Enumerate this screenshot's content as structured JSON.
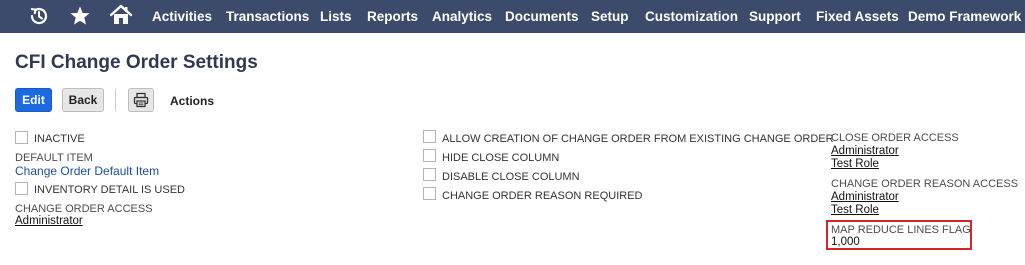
{
  "nav": {
    "items": [
      "Activities",
      "Transactions",
      "Lists",
      "Reports",
      "Analytics",
      "Documents",
      "Setup",
      "Customization",
      "Support",
      "Fixed Assets",
      "Demo Framework"
    ],
    "icons": [
      "recent-records-icon",
      "star-icon",
      "home-icon"
    ]
  },
  "page": {
    "title": "CFI Change Order Settings"
  },
  "toolbar": {
    "edit_label": "Edit",
    "back_label": "Back",
    "print_icon": "print-icon",
    "actions_label": "Actions"
  },
  "left": {
    "inactive_label": "INACTIVE",
    "default_item_label": "DEFAULT ITEM",
    "default_item_value": "Change Order Default Item",
    "inventory_detail_label": "INVENTORY DETAIL IS USED",
    "change_order_access_label": "CHANGE ORDER ACCESS",
    "change_order_access_value": "Administrator"
  },
  "middle": {
    "allow_creation_label": "ALLOW CREATION OF CHANGE ORDER FROM EXISTING CHANGE ORDER",
    "hide_close_column_label": "HIDE CLOSE COLUMN",
    "disable_close_column_label": "DISABLE CLOSE COLUMN",
    "reason_required_label": "CHANGE ORDER REASON REQUIRED"
  },
  "right": {
    "close_order_access_label": "CLOSE ORDER ACCESS",
    "close_order_access_values": [
      "Administrator",
      "Test Role"
    ],
    "reason_access_label": "CHANGE ORDER REASON ACCESS",
    "reason_access_values": [
      "Administrator",
      "Test Role"
    ],
    "map_reduce_label": "MAP REDUCE LINES FLAG",
    "map_reduce_value": "1,000"
  },
  "colors": {
    "navbar": "#3c4a6c",
    "primary_button": "#1b6ae0",
    "highlight": "#d32626"
  }
}
